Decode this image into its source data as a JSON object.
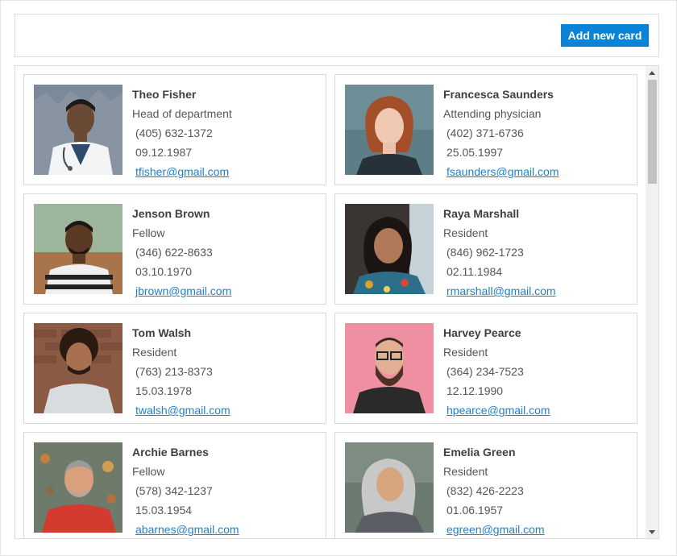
{
  "toolbar": {
    "add_button_label": "Add new card"
  },
  "cards": [
    {
      "name": "Theo Fisher",
      "role": "Head of department",
      "phone": "(405) 632-1372",
      "dob": "09.12.1987",
      "email": "tfisher@gmail.com"
    },
    {
      "name": "Francesca Saunders",
      "role": "Attending physician",
      "phone": "(402) 371-6736",
      "dob": "25.05.1997",
      "email": "fsaunders@gmail.com"
    },
    {
      "name": "Jenson Brown",
      "role": "Fellow",
      "phone": "(346) 622-8633",
      "dob": "03.10.1970",
      "email": "jbrown@gmail.com"
    },
    {
      "name": "Raya Marshall",
      "role": "Resident",
      "phone": "(846) 962-1723",
      "dob": "02.11.1984",
      "email": "rmarshall@gmail.com"
    },
    {
      "name": "Tom Walsh",
      "role": "Resident",
      "phone": "(763) 213-8373",
      "dob": "15.03.1978",
      "email": "twalsh@gmail.com"
    },
    {
      "name": "Harvey Pearce",
      "role": "Resident",
      "phone": "(364) 234-7523",
      "dob": "12.12.1990",
      "email": "hpearce@gmail.com"
    },
    {
      "name": "Archie Barnes",
      "role": "Fellow",
      "phone": "(578) 342-1237",
      "dob": "15.03.1954",
      "email": "abarnes@gmail.com"
    },
    {
      "name": "Emelia Green",
      "role": "Resident",
      "phone": "(832) 426-2223",
      "dob": "01.06.1957",
      "email": "egreen@gmail.com"
    }
  ]
}
